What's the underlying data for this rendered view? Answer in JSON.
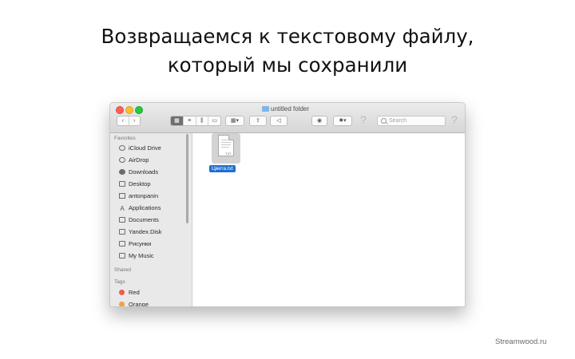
{
  "slide": {
    "title_line1": "Возвращаемся к текстовому файлу,",
    "title_line2": "который мы сохранили",
    "watermark": "Streamwood.ru"
  },
  "window": {
    "title": "untitled folder",
    "toolbar": {
      "back_icon": "chevron-left-icon",
      "forward_icon": "chevron-right-icon",
      "view_modes": [
        "icon-view",
        "list-view",
        "column-view",
        "cover-flow-view"
      ],
      "active_view": "icon-view",
      "arrange_icon": "grid-icon",
      "share_icon": "share-icon",
      "tags_icon": "tag-icon",
      "eye_icon": "eye-icon",
      "gear_icon": "gear-icon",
      "help_glyph": "?",
      "search_placeholder": "Search"
    },
    "sidebar": {
      "favorites_header": "Favorites",
      "favorites": [
        {
          "label": "iCloud Drive",
          "icon": "cloud-icon"
        },
        {
          "label": "AirDrop",
          "icon": "airdrop-icon"
        },
        {
          "label": "Downloads",
          "icon": "download-icon"
        },
        {
          "label": "Desktop",
          "icon": "desktop-icon"
        },
        {
          "label": "antonpanin",
          "icon": "home-icon"
        },
        {
          "label": "Applications",
          "icon": "applications-icon"
        },
        {
          "label": "Documents",
          "icon": "documents-icon"
        },
        {
          "label": "Yandex.Disk",
          "icon": "folder-icon"
        },
        {
          "label": "Рисунки",
          "icon": "folder-icon"
        },
        {
          "label": "My Music",
          "icon": "music-icon"
        }
      ],
      "shared_header": "Shared",
      "tags_header": "Tags",
      "tags": [
        {
          "label": "Red",
          "color": "#f05a4f"
        },
        {
          "label": "Orange",
          "color": "#f3a23c"
        }
      ]
    },
    "files": [
      {
        "name": "Цвета.txt",
        "icon": "text-file-icon",
        "type_tag": "TXT",
        "selected": true
      }
    ]
  }
}
